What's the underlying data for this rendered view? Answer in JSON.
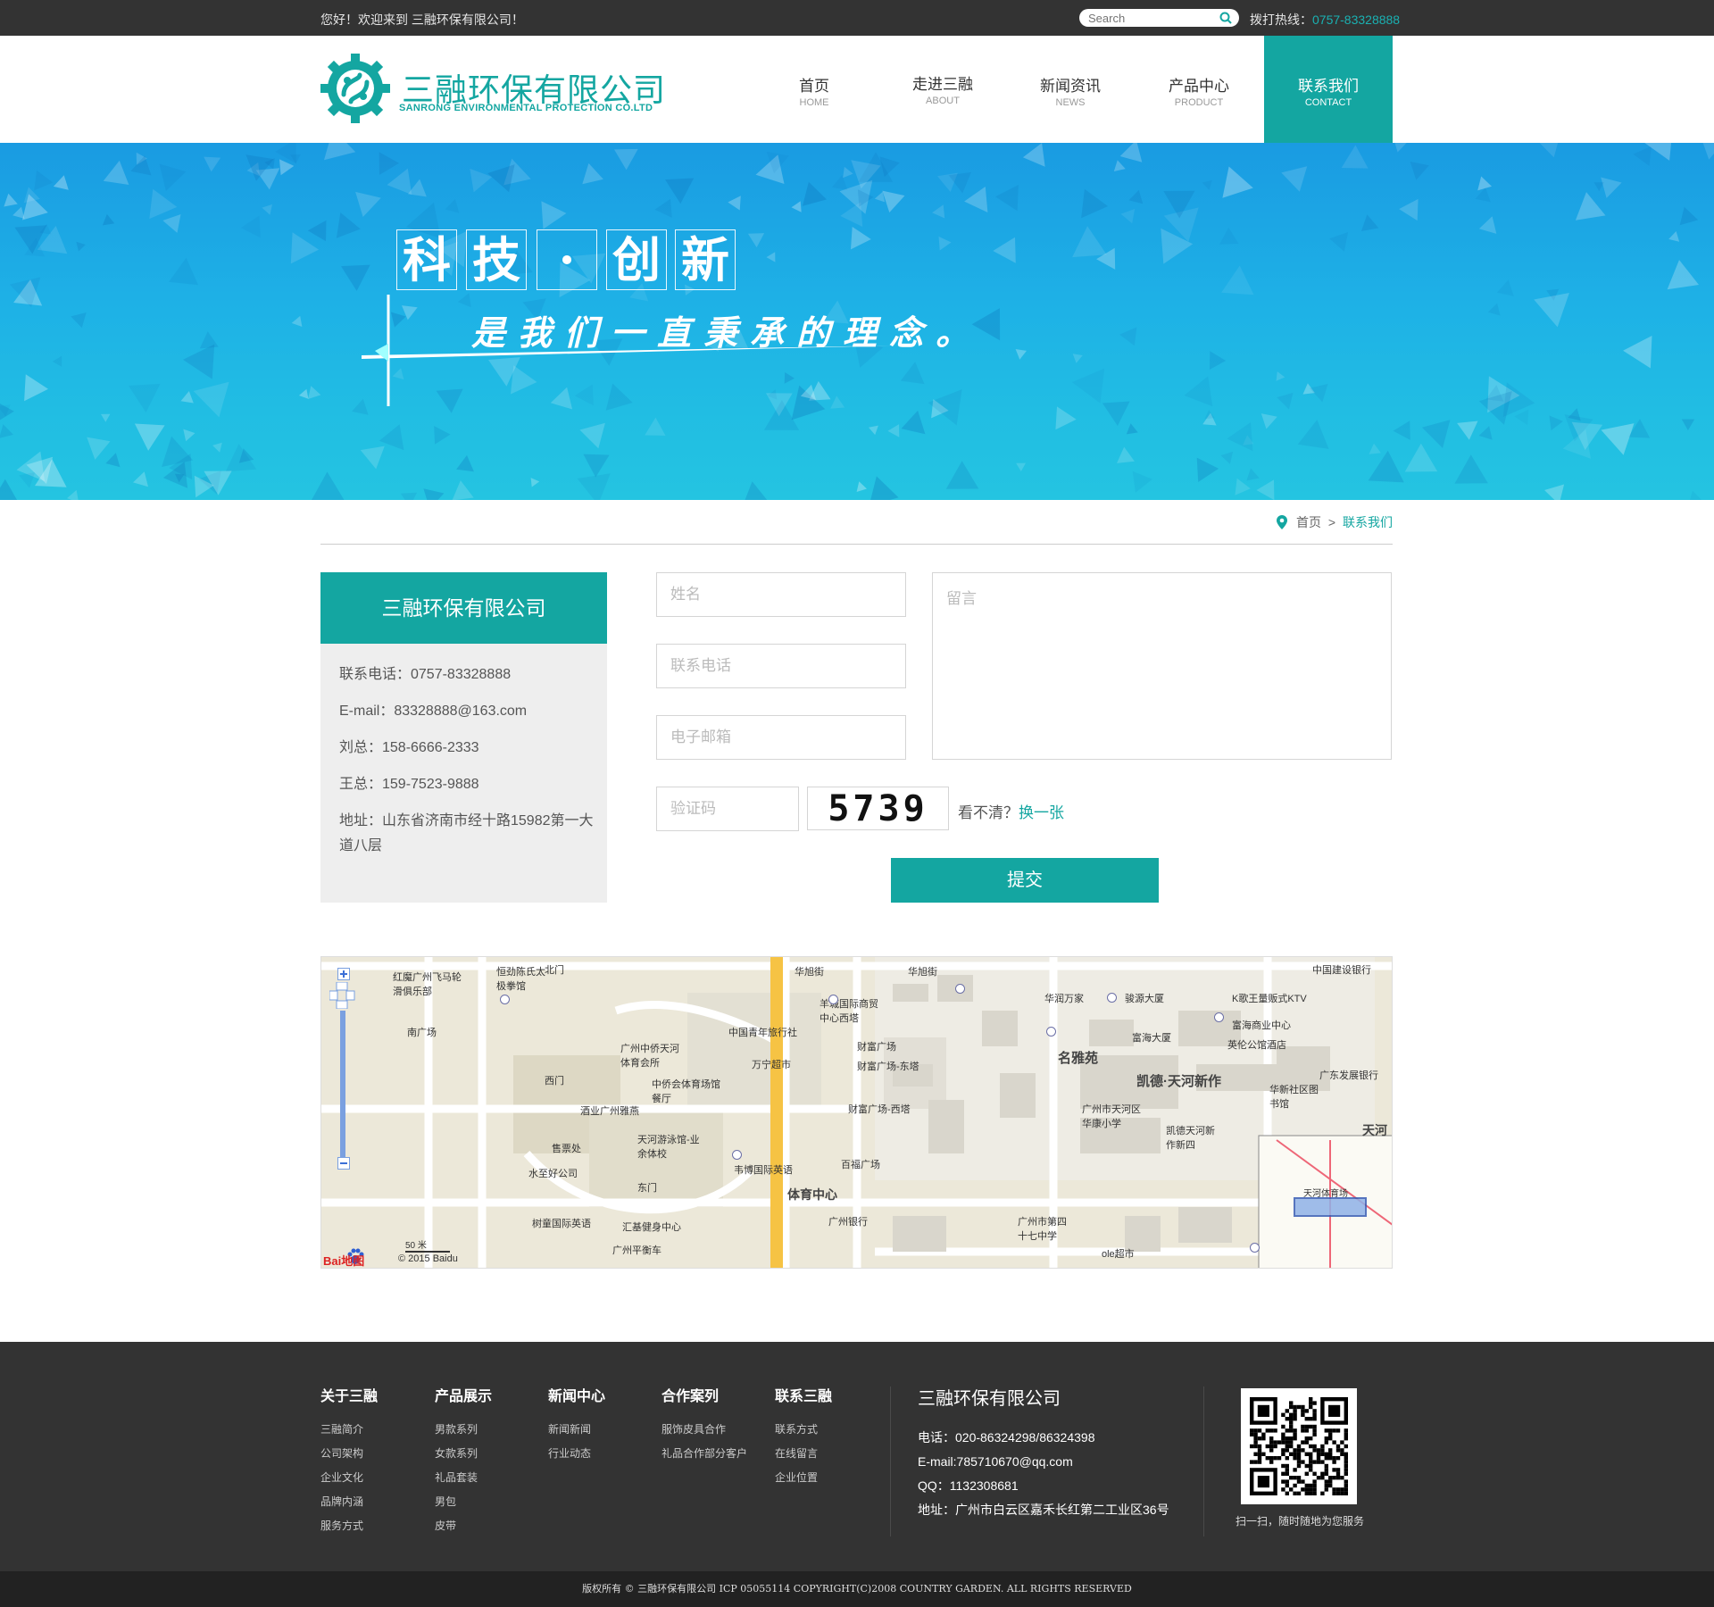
{
  "topbar": {
    "greeting": "您好！欢迎来到 三融环保有限公司！",
    "search_placeholder": "Search",
    "hotline_label": "拨打热线：",
    "hotline_number": "0757-83328888"
  },
  "logo": {
    "name": "三融环保有限公司",
    "en": "SANRONG ENVIRONMENTAL PROTECTION CO.LTD"
  },
  "nav": [
    {
      "cn": "首页",
      "en": "HOME"
    },
    {
      "cn": "走进三融",
      "en": "ABOUT"
    },
    {
      "cn": "新闻资讯",
      "en": "NEWS"
    },
    {
      "cn": "产品中心",
      "en": "PRODUCT"
    },
    {
      "cn": "联系我们",
      "en": "CONTACT"
    }
  ],
  "banner": {
    "chars": [
      "科",
      "技",
      "·",
      "创",
      "新"
    ],
    "slogan": "是我们一直秉承的理念。"
  },
  "breadcrumb": {
    "home": "首页",
    "sep": ">",
    "current": "联系我们"
  },
  "info": {
    "title": "三融环保有限公司",
    "phone": "联系电话：0757-83328888",
    "email": "E-mail：83328888@163.com",
    "liu": "刘总：158-6666-2333",
    "wang": "王总：159-7523-9888",
    "address": "地址：山东省济南市经十路15982第一大道八层"
  },
  "form": {
    "name_placeholder": "姓名",
    "phone_placeholder": "联系电话",
    "email_placeholder": "电子邮箱",
    "message_placeholder": "留言",
    "captcha_placeholder": "验证码",
    "captcha_text": "5739",
    "unclear": "看不清？",
    "refresh": "换一张",
    "submit": "提交"
  },
  "map": {
    "labels": [
      "华旭街",
      "华旭街",
      "广州中侨天河体育会所",
      "中侨会体育场馆餐厅",
      "名雅苑",
      "凯德·天河新作",
      "体育中心",
      "广州市第四十七中学",
      "广州银行",
      "天河游泳馆-业余体校",
      "韦博国际英语",
      "百福广场",
      "财富广场",
      "财富广场-东塔",
      "财富广场-西塔",
      "华润万家",
      "骏源大厦",
      "富海大厦",
      "富海商业中心",
      "英伦公馆酒店",
      "广州市天河区华康小学",
      "华新社区图书馆",
      "凯德天河新作新四",
      "汇基健身中心",
      "树童国际英语",
      "水至好公司",
      "售票处",
      "东门",
      "西门",
      "南广场",
      "北门",
      "中国青年旅行社",
      "万宁超市",
      "中国建设银行",
      "K歌王量贩式KTV",
      "ole超市",
      "天河体育场",
      "天河",
      "红魔广州飞马轮滑俱乐部",
      "恒劲陈氏太极拳馆",
      "广东发展银行",
      "广州平衡车",
      "羊城国际商贸中心西塔",
      "酒业广州雅燕"
    ],
    "scale": "50 米",
    "copyright": "© 2015 Baidu",
    "brand": "Bai地图"
  },
  "footer": {
    "columns": [
      {
        "title": "关于三融",
        "items": [
          "三融简介",
          "公司架构",
          "企业文化",
          "品牌内涵",
          "服务方式"
        ]
      },
      {
        "title": "产品展示",
        "items": [
          "男款系列",
          "女款系列",
          "礼品套装",
          "男包",
          "皮带"
        ]
      },
      {
        "title": "新闻中心",
        "items": [
          "新闻新闻",
          "行业动态"
        ]
      },
      {
        "title": "合作案列",
        "items": [
          "服饰皮具合作",
          "礼品合作部分客户"
        ]
      },
      {
        "title": "联系三融",
        "items": [
          "联系方式",
          "在线留言",
          "企业位置"
        ]
      }
    ],
    "company": "三融环保有限公司",
    "tel": "电话：020-86324298/86324398",
    "email": "E-mail:785710670@qq.com",
    "qq": "QQ：1132308681",
    "address": "地址：广州市白云区嘉禾长红第二工业区36号",
    "qr_caption": "扫一扫，随时随地为您服务"
  },
  "copyright": "版权所有 © 三融环保有限公司 ICP 05055114 COPYRIGHT(C)2008 COUNTRY GARDEN. ALL RIGHTS RESERVED",
  "colors": {
    "accent": "#14a6a1",
    "dark": "#333333",
    "banner": "#1eb1e6"
  }
}
